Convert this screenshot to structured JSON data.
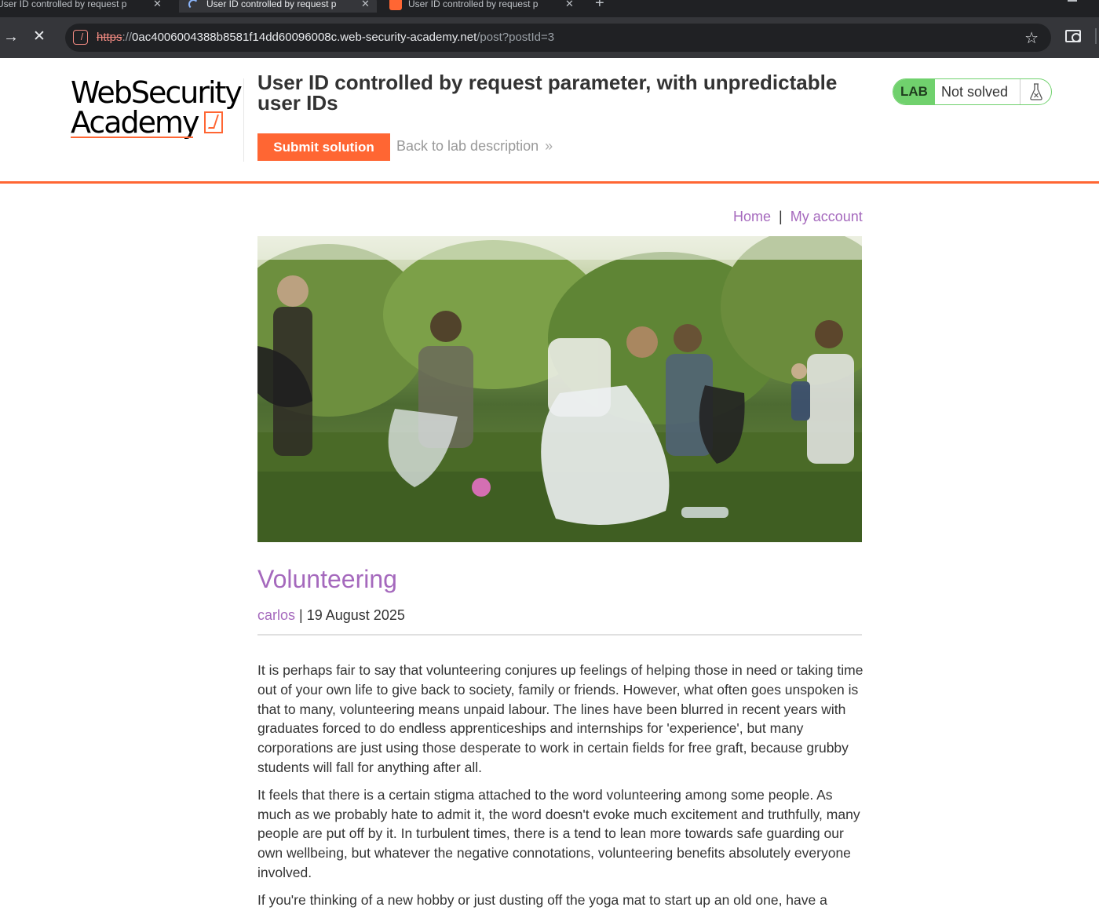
{
  "browser": {
    "tabs": [
      {
        "title": "User ID controlled by request p",
        "active": false
      },
      {
        "title": "User ID controlled by request p",
        "active": true,
        "loading": true
      },
      {
        "title": "User ID controlled by request p",
        "active": false
      }
    ],
    "url": {
      "scheme": "https",
      "separator": "://",
      "host": "0ac4006004388b8581f14dd60096008c.web-security-academy.net",
      "path": "/post?postId=3"
    },
    "icons": [
      "forward-icon",
      "stop-icon",
      "site-info-icon",
      "bookmark-star-icon",
      "cast-icon"
    ]
  },
  "header": {
    "logo": {
      "line1": "WebSecurity",
      "line2": "Academy"
    },
    "lab_title": "User ID controlled by request parameter, with unpredictable user IDs",
    "submit_label": "Submit solution",
    "back_label": "Back to lab description",
    "back_chevron": "»",
    "status_badge": "LAB",
    "status_text": "Not solved",
    "accent_color": "#ff6633",
    "status_color": "#70d16d"
  },
  "nav": {
    "home": "Home",
    "separator": "|",
    "account": "My account"
  },
  "post": {
    "title": "Volunteering",
    "author": "carlos",
    "meta_separator": "|",
    "date": "19 August 2025",
    "paragraphs": [
      "It is perhaps fair to say that volunteering conjures up feelings of helping those in need or taking time out of your own life to give back to society, family or friends. However, what often goes unspoken is that to many, volunteering means unpaid labour. The lines have been blurred in recent years with graduates forced to do endless apprenticeships and internships for 'experience', but many corporations are just using those desperate to work in certain fields for free graft, because grubby students will fall for anything after all.",
      "It feels that there is a certain stigma attached to the word volunteering among some people. As much as we probably hate to admit it, the word doesn't evoke much excitement and truthfully, many people are put off by it. In turbulent times, there is a tend to lean more towards safe guarding our own wellbeing, but whatever the negative connotations, volunteering benefits absolutely everyone involved.",
      "If you're thinking of a new hobby or just dusting off the yoga mat to start up an old one, have a"
    ],
    "link_color": "#a569bd"
  }
}
